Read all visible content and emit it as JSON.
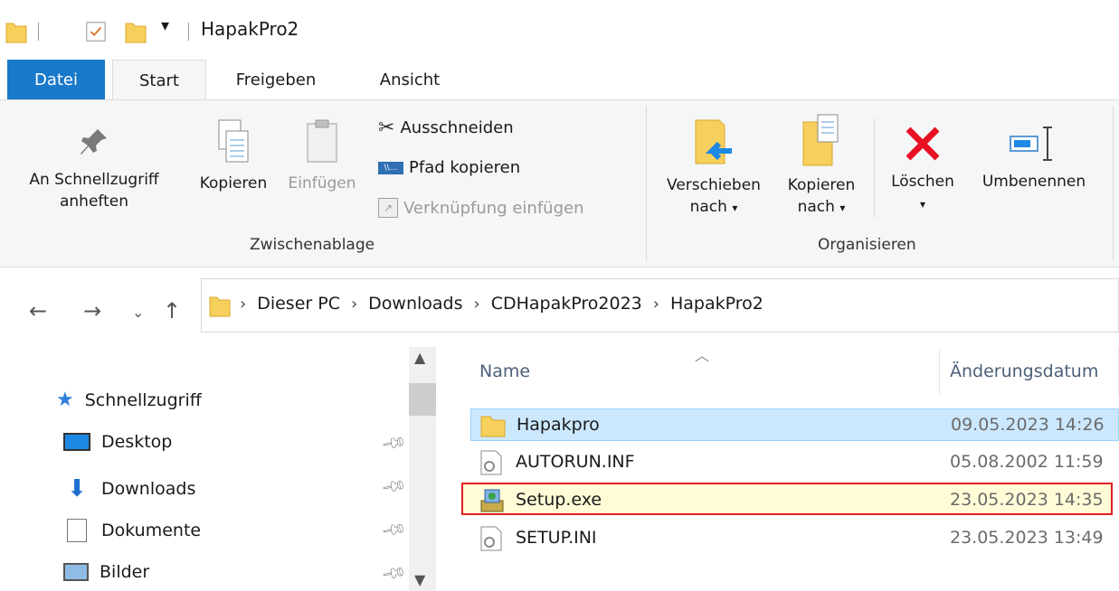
{
  "window": {
    "title": "HapakPro2"
  },
  "tabs": {
    "file": "Datei",
    "start": "Start",
    "share": "Freigeben",
    "view": "Ansicht"
  },
  "ribbon": {
    "clipboard": {
      "pin_line1": "An Schnellzugriff",
      "pin_line2": "anheften",
      "copy": "Kopieren",
      "paste": "Einfügen",
      "cut": "Ausschneiden",
      "copy_path": "Pfad kopieren",
      "paste_shortcut": "Verknüpfung einfügen",
      "group_label": "Zwischenablage"
    },
    "organize": {
      "move_line1": "Verschieben",
      "move_line2": "nach",
      "copyto_line1": "Kopieren",
      "copyto_line2": "nach",
      "delete": "Löschen",
      "rename": "Umbenennen",
      "group_label": "Organisieren"
    }
  },
  "address": {
    "crumbs": [
      "Dieser PC",
      "Downloads",
      "CDHapakPro2023",
      "HapakPro2"
    ]
  },
  "navpane": {
    "quick_access": "Schnellzugriff",
    "items": [
      "Desktop",
      "Downloads",
      "Dokumente",
      "Bilder"
    ]
  },
  "list": {
    "col_name": "Name",
    "col_date": "Änderungsdatum",
    "rows": [
      {
        "name": "Hapakpro",
        "date": "09.05.2023 14:26",
        "type": "folder"
      },
      {
        "name": "AUTORUN.INF",
        "date": "05.08.2002 11:59",
        "type": "config"
      },
      {
        "name": "Setup.exe",
        "date": "23.05.2023 14:35",
        "type": "installer"
      },
      {
        "name": "SETUP.INI",
        "date": "23.05.2023 13:49",
        "type": "config"
      }
    ]
  },
  "colors": {
    "accent": "#1979ca",
    "folder": "#f7cf5c",
    "delete": "#e81123",
    "selection": "#cce8ff",
    "highlight_border": "#e02020"
  }
}
